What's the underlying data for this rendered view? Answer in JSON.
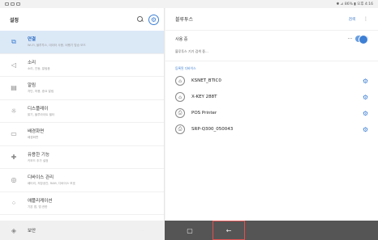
{
  "statusbar": {
    "left_icons": 3,
    "right_text": "✱ ⊿ 86% ▮ 오후 4:16"
  },
  "left": {
    "title": "설정",
    "items": [
      {
        "title": "연결",
        "sub": "Wi-Fi, 블루투스, 데이터 사용, 비행기 탑승 모드",
        "icon": "link-icon",
        "glyph": "⧉",
        "selected": true
      },
      {
        "title": "소리",
        "sub": "소리, 진동, 알림음",
        "icon": "sound-icon",
        "glyph": "◁",
        "selected": false
      },
      {
        "title": "알림",
        "sub": "차단, 허용, 중요 알림",
        "icon": "notification-icon",
        "glyph": "▤",
        "selected": false
      },
      {
        "title": "디스플레이",
        "sub": "밝기, 블루라이트 필터",
        "icon": "display-icon",
        "glyph": "☼",
        "selected": false
      },
      {
        "title": "배경화면",
        "sub": "배경화면",
        "icon": "wallpaper-icon",
        "glyph": "▭",
        "selected": false
      },
      {
        "title": "유용한 기능",
        "sub": "키보드 추가 설정",
        "icon": "advanced-features-icon",
        "glyph": "✚",
        "selected": false
      },
      {
        "title": "디바이스 관리",
        "sub": "배터리, 저장공간, RAM, 디바이스 보호",
        "icon": "device-care-icon",
        "glyph": "◎",
        "selected": false
      },
      {
        "title": "애플리케이션",
        "sub": "기본 앱, 앱 권한",
        "icon": "apps-icon",
        "glyph": "⁘",
        "selected": false
      },
      {
        "title": "잠금화면",
        "sub": "화면 잠금 방식, 시계 스타일",
        "icon": "lock-screen-icon",
        "glyph": "▣",
        "selected": false
      }
    ],
    "partial_item": "보안"
  },
  "right": {
    "title": "블루투스",
    "scan_label": "검색",
    "more_label": "⋮",
    "toggle_label": "사용 중",
    "toggle_on": true,
    "note": "블루투스 기기 검색 중...",
    "section_label": "등록된 디바이스",
    "devices": [
      {
        "name": "KSNET_BTIC0",
        "icon": "bluetooth-device-icon",
        "glyph": "⌂"
      },
      {
        "name": "X-KEY 288T",
        "icon": "bluetooth-device-icon",
        "glyph": "⌂"
      },
      {
        "name": "POS Printer",
        "icon": "printer-icon",
        "glyph": "⎙"
      },
      {
        "name": "SRP-Q300_050043",
        "icon": "printer-icon",
        "glyph": "⎙"
      }
    ]
  },
  "navbar": {
    "recent_glyph": "⫤",
    "home_glyph": "▢",
    "back_glyph": "←"
  },
  "colors": {
    "accent": "#3d7fd4",
    "selected_bg": "#dbe8f6",
    "navbar": "#555555"
  }
}
